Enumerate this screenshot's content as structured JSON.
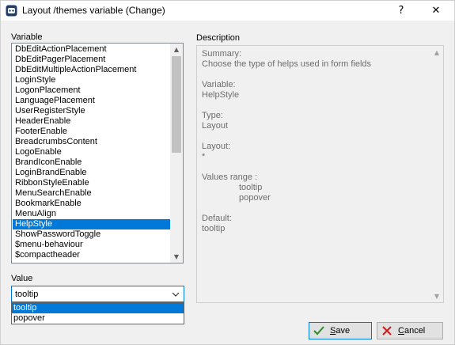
{
  "window": {
    "title": "Layout /themes variable (Change)",
    "help_glyph": "?",
    "close_glyph": "✕"
  },
  "labels": {
    "variable": "Variable",
    "description": "Description",
    "value": "Value"
  },
  "variables": [
    "DbEditActionPlacement",
    "DbEditPagerPlacement",
    "DbEditMultipleActionPlacement",
    "LoginStyle",
    "LogonPlacement",
    "LanguagePlacement",
    "UserRegisterStyle",
    "HeaderEnable",
    "FooterEnable",
    "BreadcrumbsContent",
    "LogoEnable",
    "BrandIconEnable",
    "LoginBrandEnable",
    "RibbonStyleEnable",
    "MenuSearchEnable",
    "BookmarkEnable",
    "MenuAlign",
    "HelpStyle",
    "ShowPasswordToggle",
    "$menu-behaviour",
    "$compactheader"
  ],
  "selected_variable": "HelpStyle",
  "description": {
    "summary_label": "Summary:",
    "summary": "Choose the type of helps used in form fields",
    "variable_label": "Variable:",
    "variable": "HelpStyle",
    "type_label": "Type:",
    "type": "Layout",
    "layout_label": "Layout:",
    "layout": "*",
    "range_label": "Values range :",
    "range": [
      "tooltip",
      "popover"
    ],
    "default_label": "Default:",
    "default": "tooltip"
  },
  "value": {
    "current": "tooltip",
    "options": [
      "tooltip",
      "popover"
    ],
    "highlighted": "tooltip"
  },
  "buttons": {
    "save_mnemonic": "S",
    "save_rest": "ave",
    "cancel_mnemonic": "C",
    "cancel_rest": "ancel"
  },
  "colors": {
    "selection": "#0078d7",
    "save_check": "#2e8b2e",
    "cancel_x": "#d11b1b"
  }
}
